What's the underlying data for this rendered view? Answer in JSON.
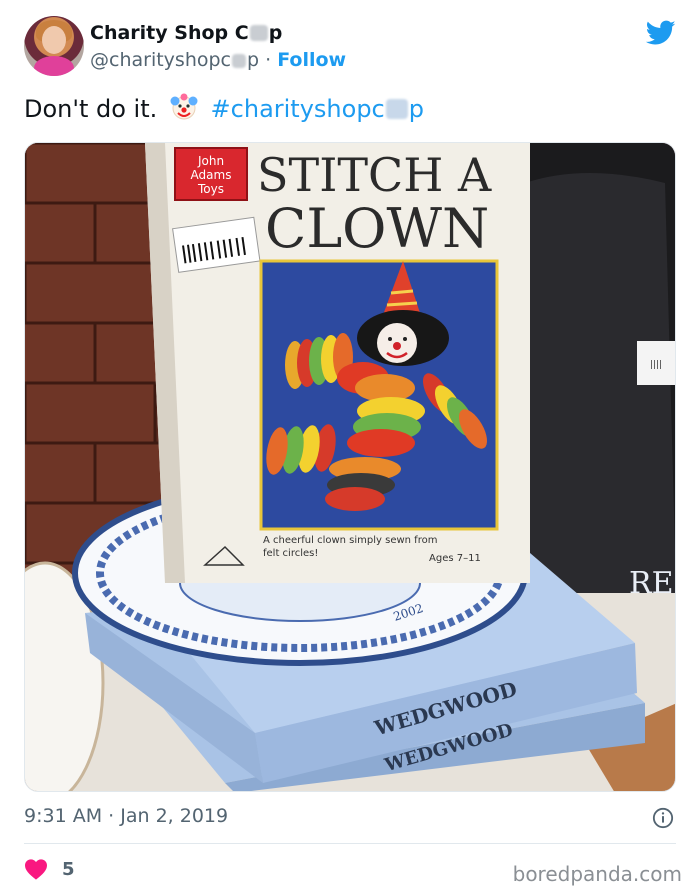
{
  "author": {
    "name_prefix": "Charity Shop C",
    "name_suffix": "p",
    "handle_prefix": "@charityshopc",
    "handle_suffix": "p",
    "separator": "·",
    "follow_label": "Follow"
  },
  "tweet": {
    "text": "Don't do it.",
    "hashtag_prefix": "#charityshopc",
    "hashtag_suffix": "p",
    "emoji": "clown-face"
  },
  "photo": {
    "box_brand_line1": "John",
    "box_brand_line2": "Adams",
    "box_brand_line3": "Toys",
    "box_title_line1": "STITCH A",
    "box_title_line2": "CLOWN",
    "box_caption_line1": "A cheerful clown simply sewn from",
    "box_caption_line2": "felt circles!",
    "box_ages": "Ages 7–11",
    "plate_year": "2002",
    "brand_box1": "WEDGWOOD",
    "brand_box2": "WEDGWOOD",
    "edge_text": "RE"
  },
  "meta": {
    "time": "9:31 AM",
    "separator": "·",
    "date": "Jan 2, 2019"
  },
  "engagement": {
    "likes": "5"
  },
  "watermark": "boredpanda.com",
  "colors": {
    "accent": "#1d9bf0",
    "heart": "#f91880",
    "text": "#0f1419",
    "secondary": "#536471"
  }
}
